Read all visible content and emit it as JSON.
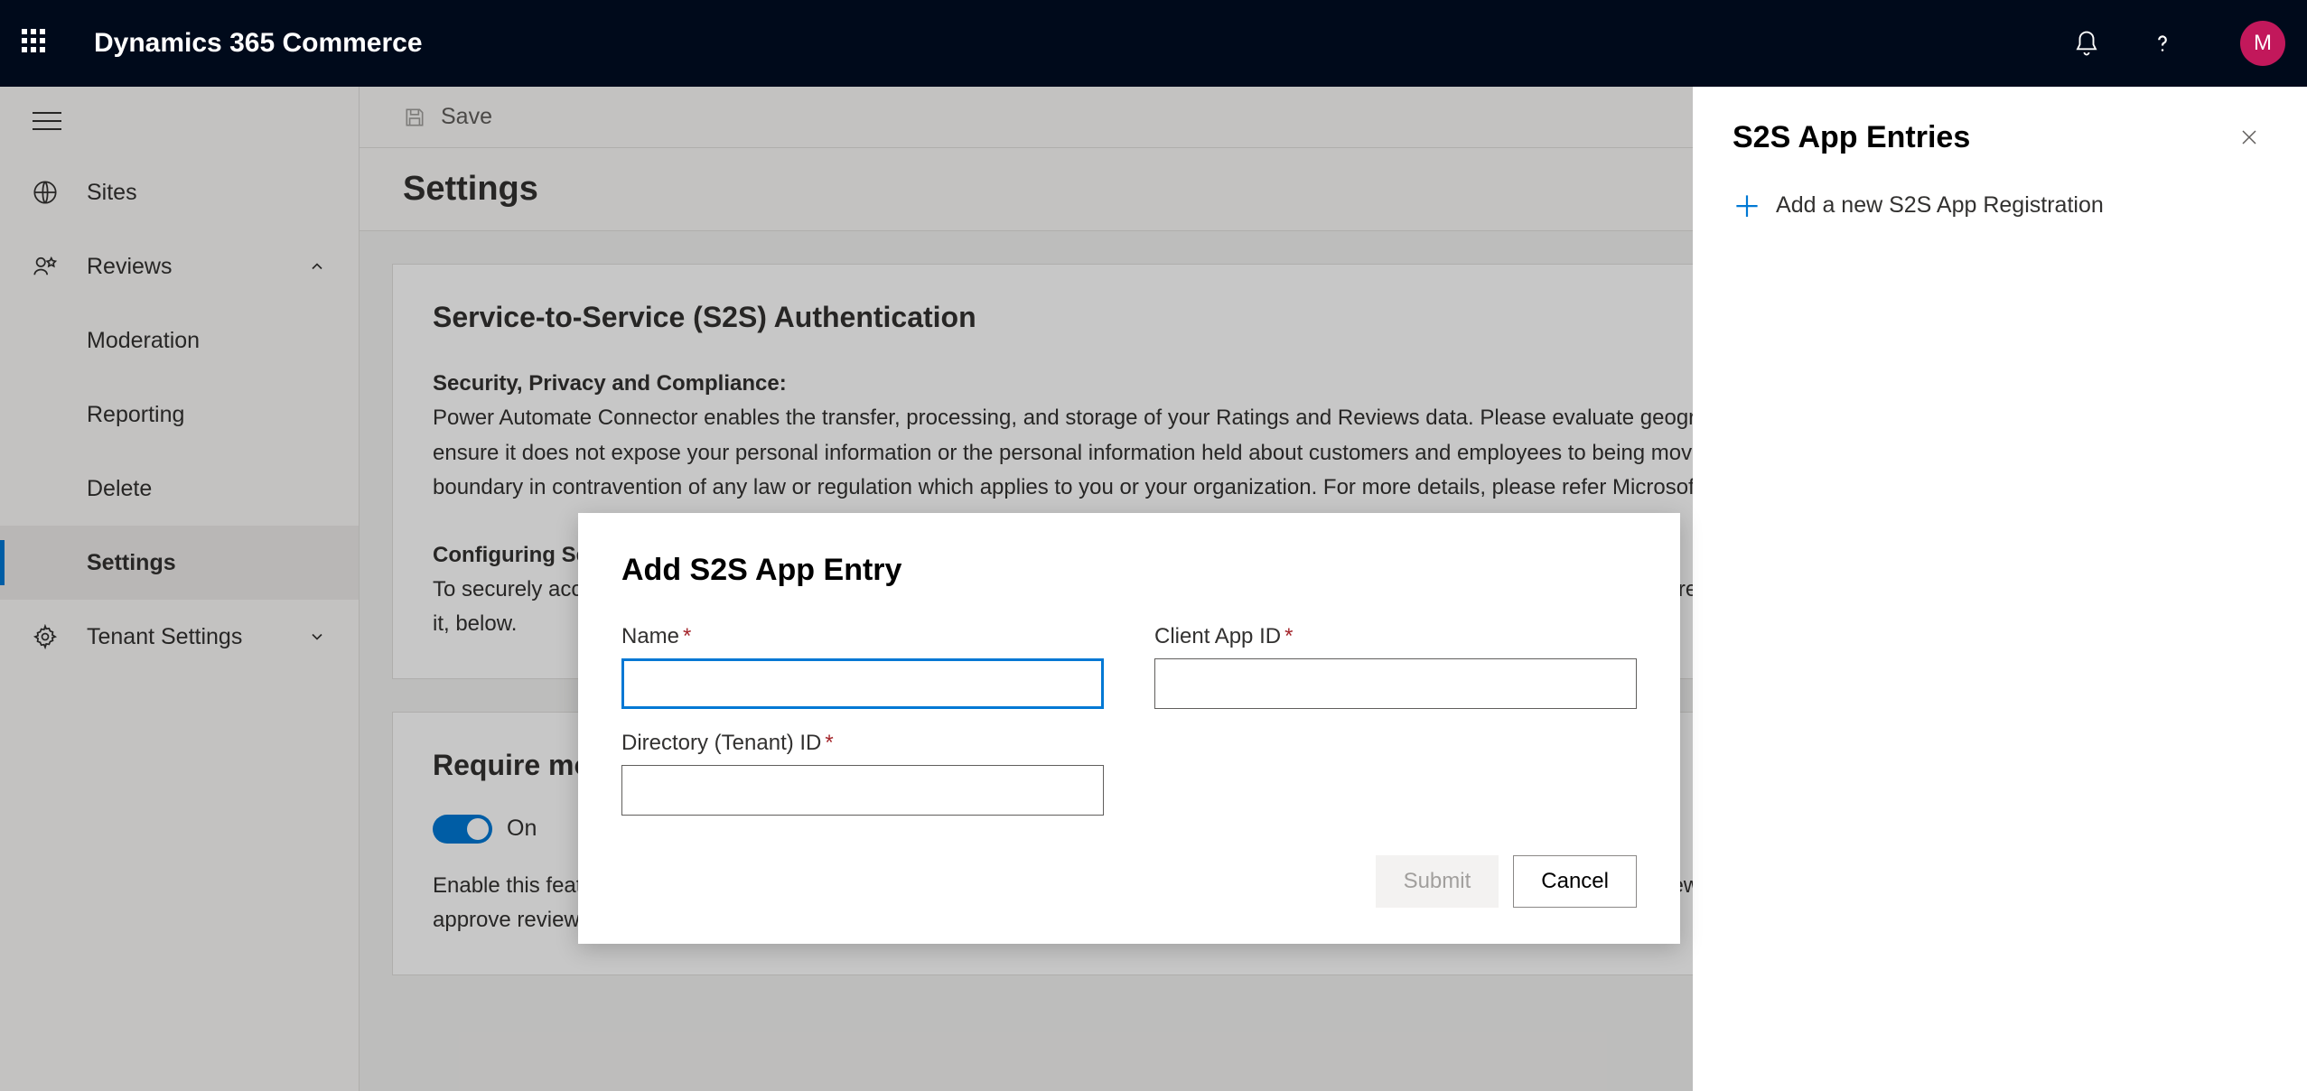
{
  "topbar": {
    "app_title": "Dynamics 365 Commerce",
    "avatar_initial": "M"
  },
  "nav": {
    "sites": "Sites",
    "reviews": "Reviews",
    "moderation": "Moderation",
    "reporting": "Reporting",
    "delete": "Delete",
    "settings": "Settings",
    "tenant_settings": "Tenant Settings"
  },
  "commandbar": {
    "save": "Save"
  },
  "page": {
    "title": "Settings"
  },
  "s2s": {
    "heading": "Service-to-Service (S2S) Authentication",
    "sec_label": "Security, Privacy and Compliance:",
    "sec_body_1": "Power Automate Connector enables the transfer, processing, and storage of your Ratings and Reviews data. Please evaluate geographical requirements before enabling the Connector to ensure it does not expose your personal information or the personal information held about customers and employees to being moved, processed or stored in any geography or compliance boundary in contravention of any law or regulation which applies to you or your organization. For more details, please refer Microsoft Privacy Statement. ",
    "sec_link": "Microsoft Privacy Statement",
    "cfg_label": "Configuring Service-to-Service Authentication",
    "cfg_body": "To securely access cross-service APIs, first register a web application under your tenant via Azure Active Directory. Add the newly registered application, as well as the Client ID assigned to it, below."
  },
  "moderator": {
    "heading": "Require moderator for ratings and reviews",
    "toggle_label": "On",
    "desc": "Enable this feature to require a moderator to approve ratings and reviews before publishing. Enabling this feature will prevent reviews from being automatically published. Moderators must approve reviews for publishing. Azure Cognitive Services will continue to filter profanity in titles and content."
  },
  "panel": {
    "title": "S2S App Entries",
    "add_label": "Add a new S2S App Registration"
  },
  "modal": {
    "title": "Add S2S App Entry",
    "name_label": "Name",
    "client_label": "Client App ID",
    "tenant_label": "Directory (Tenant) ID",
    "submit": "Submit",
    "cancel": "Cancel"
  }
}
